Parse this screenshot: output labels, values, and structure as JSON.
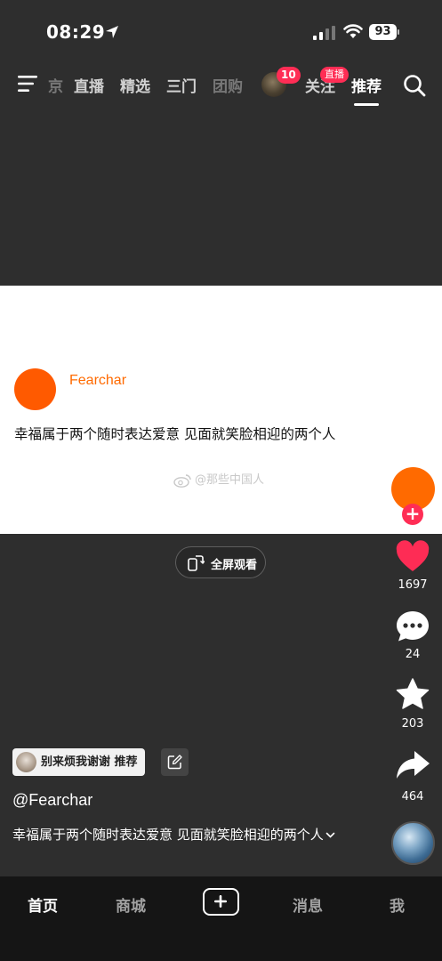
{
  "status_bar": {
    "time": "08:29",
    "battery": "93"
  },
  "top_nav": {
    "tabs": [
      {
        "label": "京"
      },
      {
        "label": "直播"
      },
      {
        "label": "精选"
      },
      {
        "label": "三门"
      },
      {
        "label": "团购"
      },
      {
        "label": "关注"
      },
      {
        "label": "推荐"
      }
    ],
    "notification_count": "10",
    "live_badge": "直播",
    "active_tab": "推荐"
  },
  "card": {
    "author": "Fearchar",
    "text": "幸福属于两个随时表达爱意 见面就笑脸相迎的两个人",
    "watermark": "@那些中国人"
  },
  "fullscreen_button": {
    "label": "全屏观看"
  },
  "right_rail": {
    "likes": "1697",
    "comments": "24",
    "favorites": "203",
    "shares": "464"
  },
  "post": {
    "music_tag": "别来烦我谢谢 推荐",
    "handle": "@Fearchar",
    "caption": "幸福属于两个随时表达爱意 见面就笑脸相迎的两个人"
  },
  "bottom_nav": {
    "home": "首页",
    "mall": "商城",
    "messages": "消息",
    "me": "我"
  },
  "colors": {
    "accent": "#ff2d55",
    "avatar_orange": "#ff6a00",
    "like_red": "#fe2c55"
  },
  "icons": [
    "location-arrow-icon",
    "signal-icon",
    "wifi-icon",
    "battery-icon",
    "menu-icon",
    "search-icon",
    "fullscreen-rotate-icon",
    "heart-icon",
    "comment-icon",
    "star-icon",
    "share-icon",
    "edit-icon",
    "chevron-down-icon",
    "plus-icon"
  ]
}
